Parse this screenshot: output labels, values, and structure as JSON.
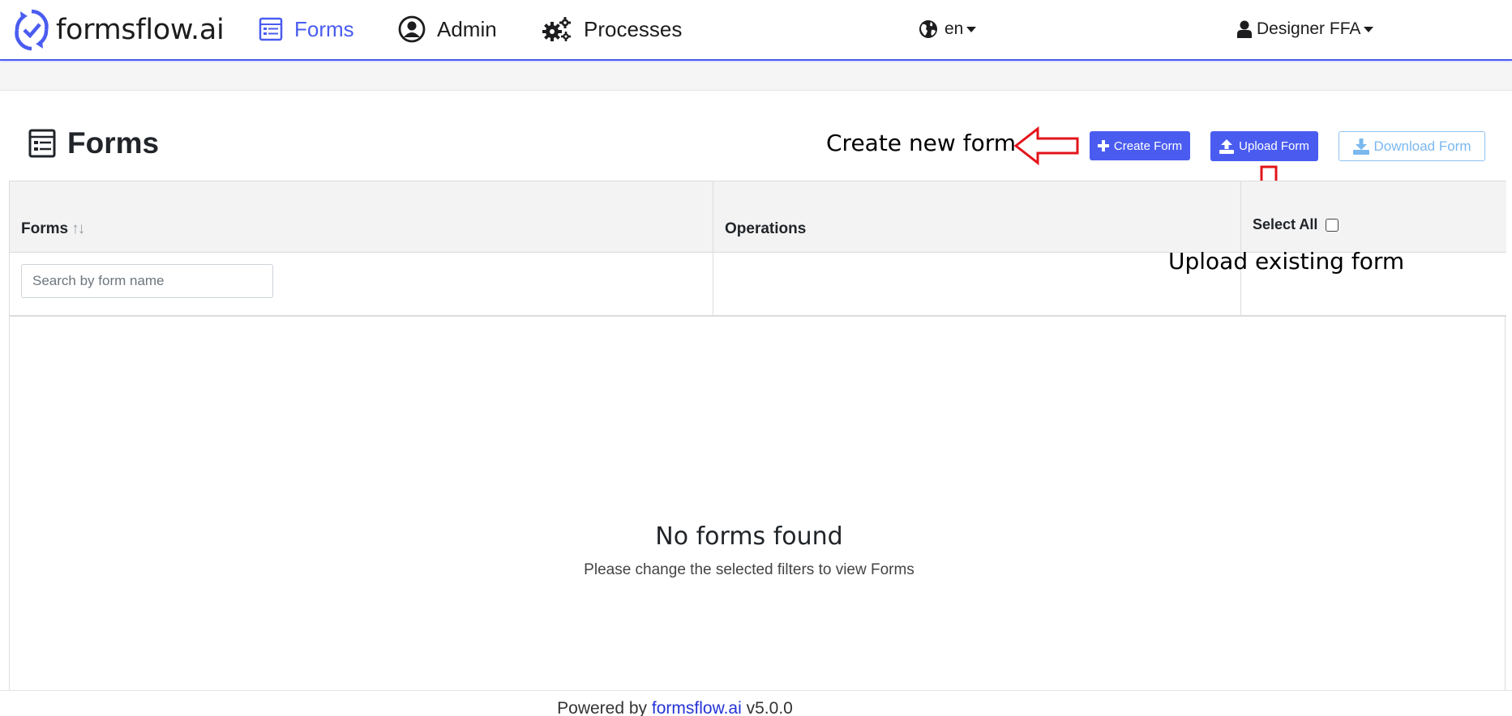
{
  "navbar": {
    "brand": "formsflow.ai",
    "items": [
      {
        "label": "Forms",
        "icon": "forms-icon",
        "active": true
      },
      {
        "label": "Admin",
        "icon": "user-circle-icon",
        "active": false
      },
      {
        "label": "Processes",
        "icon": "gears-icon",
        "active": false
      }
    ],
    "language": "en",
    "user": "Designer FFA",
    "accent_color": "#4a5cf0"
  },
  "page": {
    "title": "Forms",
    "title_icon": "forms-icon"
  },
  "annotations": {
    "create": "Create new form",
    "upload": "Upload existing form",
    "arrow_color": "#e3141b"
  },
  "buttons": {
    "create": "Create Form",
    "upload": "Upload Form",
    "download": "Download Form"
  },
  "table": {
    "columns": [
      "Forms",
      "Operations",
      "Select All"
    ],
    "sort_indicator": "↑↓",
    "search_placeholder": "Search by form name",
    "empty_title": "No forms found",
    "empty_subtitle": "Please change the selected filters to view Forms"
  },
  "footer": {
    "prefix": "Powered by",
    "link": "formsflow.ai",
    "version": "v5.0.0"
  }
}
